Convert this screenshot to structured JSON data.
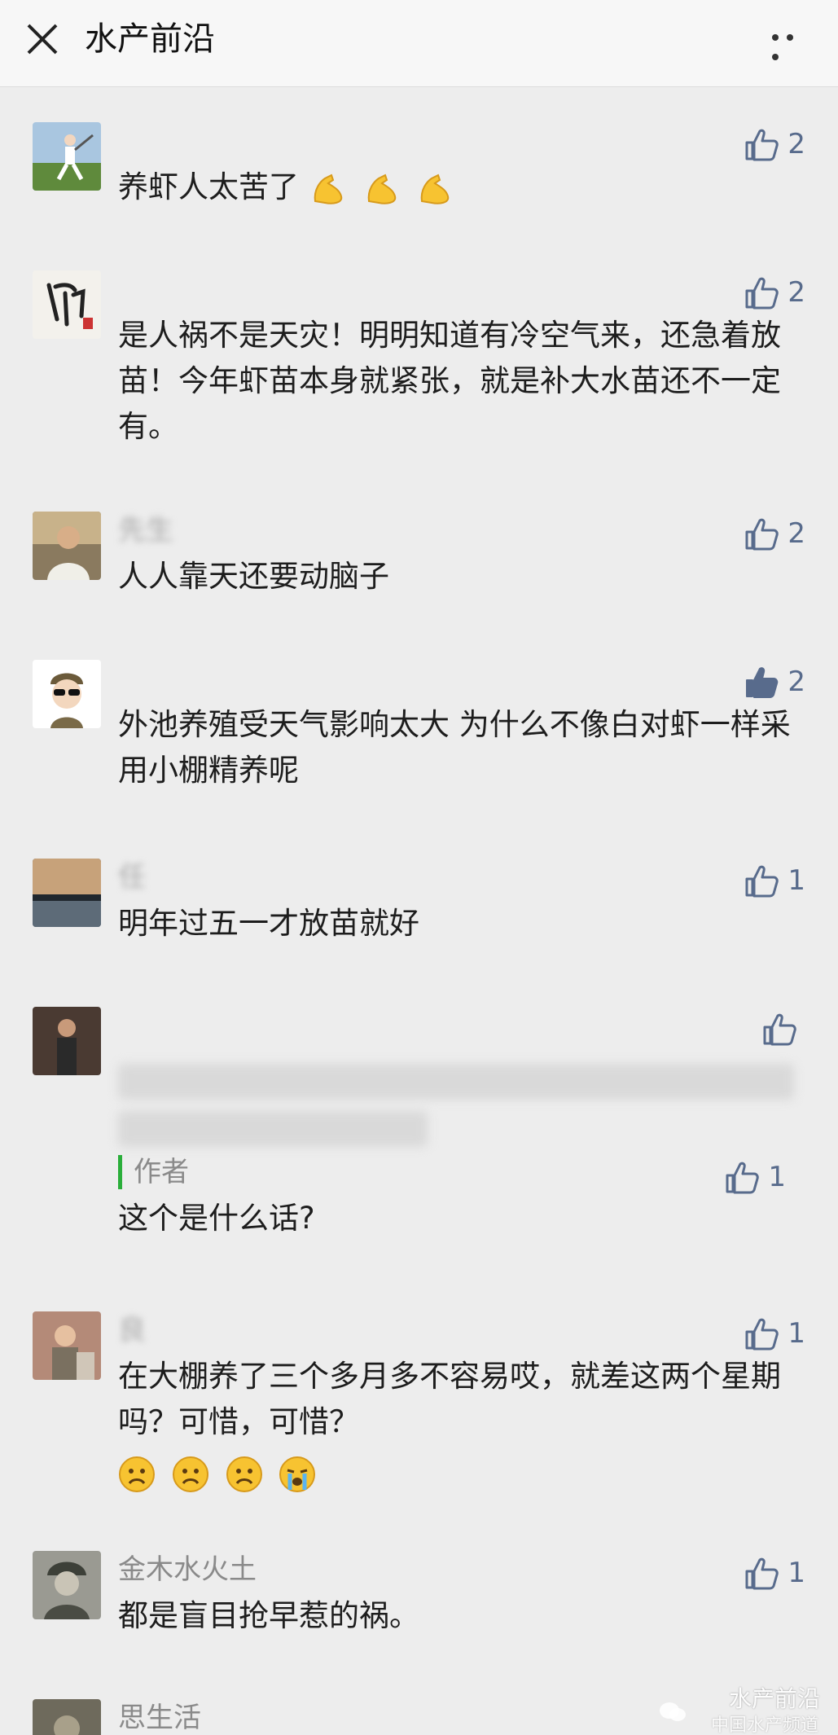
{
  "header": {
    "title": "水产前沿"
  },
  "comments": [
    {
      "nickname": "",
      "text": "养虾人太苦了",
      "likes": "2",
      "liked": false
    },
    {
      "nickname": "",
      "text": "是人祸不是天灾！明明知道有冷空气来，还急着放苗！今年虾苗本身就紧张，就是补大水苗还不一定有。",
      "likes": "2",
      "liked": false
    },
    {
      "nickname": "先生",
      "text": "人人靠天还要动脑子",
      "likes": "2",
      "liked": false
    },
    {
      "nickname": "",
      "text": "外池养殖受天气影响太大 为什么不像白对虾一样采用小棚精养呢",
      "likes": "2",
      "liked": true
    },
    {
      "nickname": "任",
      "text": "明年过五一才放苗就好",
      "likes": "1",
      "liked": false
    },
    {
      "nickname": "",
      "text": "",
      "likes": "",
      "liked": false,
      "reply": {
        "author": "作者",
        "text": "这个是什么话?",
        "likes": "1"
      }
    },
    {
      "nickname": "良",
      "text": "在大棚养了三个多月多不容易哎，就差这两个星期吗？可惜，可惜？",
      "likes": "1",
      "liked": false
    },
    {
      "nickname": "金木水火土",
      "text": "都是盲目抢早惹的祸。",
      "likes": "1",
      "liked": false
    },
    {
      "nickname": "思生活",
      "text": "",
      "likes": "",
      "liked": false
    }
  ],
  "watermark": {
    "main": "水产前沿",
    "sub": "中国水产频道"
  },
  "colors": {
    "accent": "#586b8c",
    "reply_bar": "#2aae3a",
    "emoji": "#f7c331"
  },
  "icons": [
    "close-icon",
    "more-icon",
    "thumb-up-icon",
    "flexed-biceps-emoji",
    "frowning-face-emoji",
    "crying-face-emoji"
  ]
}
